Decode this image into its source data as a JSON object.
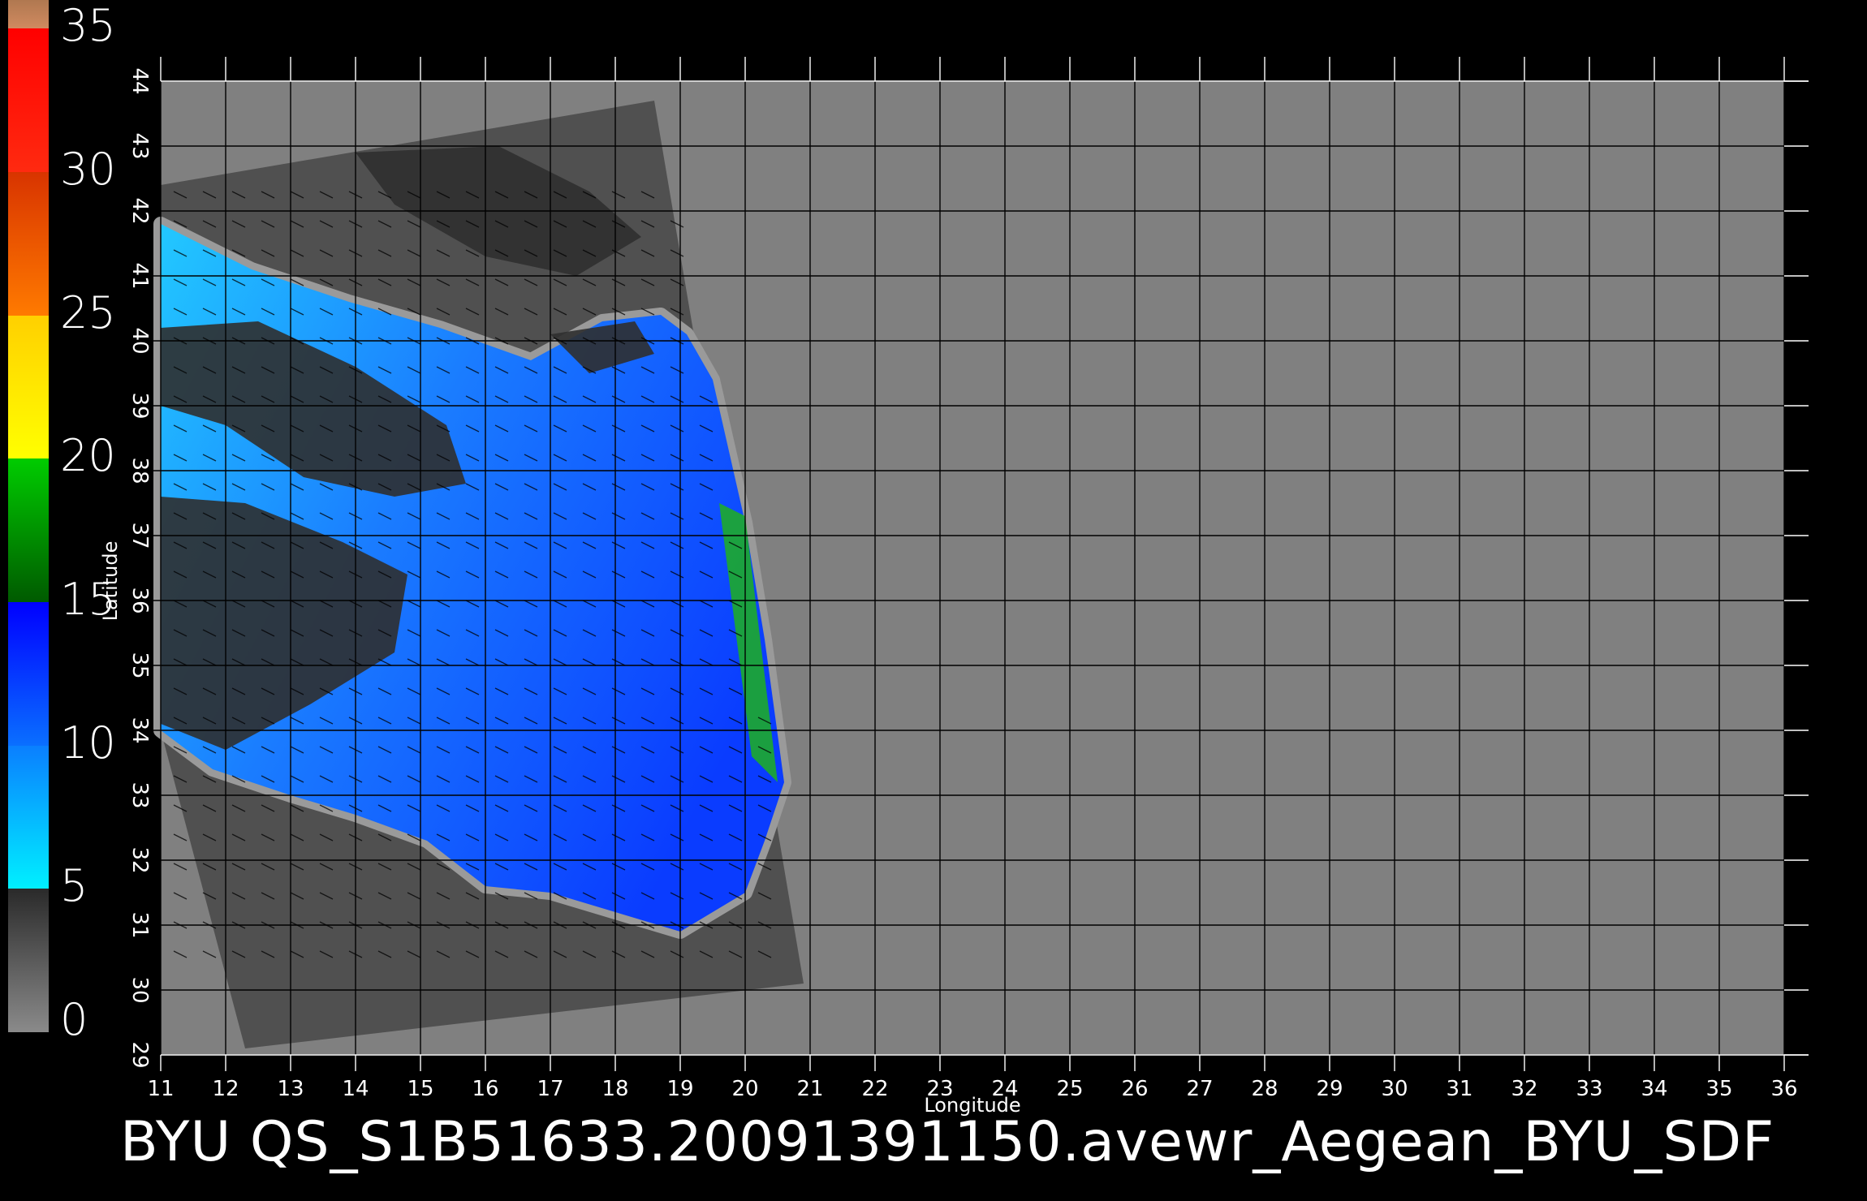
{
  "title": "BYU  QS_S1B51633.20091391150.avewr_Aegean_BYU_SDF",
  "colorbar": {
    "tick_labels": [
      "35",
      "30",
      "25",
      "20",
      "15",
      "10",
      "5",
      "0"
    ],
    "segments": [
      {
        "from": 0,
        "to": 5,
        "color_top": "#2a2a2a",
        "color_bottom": "#8a8a8a"
      },
      {
        "from": 5,
        "to": 10,
        "color_top": "#0a7fff",
        "color_bottom": "#00f0ff"
      },
      {
        "from": 10,
        "to": 15,
        "color_top": "#0000ff",
        "color_bottom": "#0a6fff"
      },
      {
        "from": 15,
        "to": 20,
        "color_top": "#00cc00",
        "color_bottom": "#005a00"
      },
      {
        "from": 20,
        "to": 25,
        "color_top": "#ffd000",
        "color_bottom": "#ffff00"
      },
      {
        "from": 25,
        "to": 30,
        "color_top": "#d83400",
        "color_bottom": "#ff7a00"
      },
      {
        "from": 30,
        "to": 35,
        "color_top": "#ff0000",
        "color_bottom": "#ff2a10"
      },
      {
        "from": 35,
        "to": 36,
        "color_top": "#b07850",
        "color_bottom": "#d08a60"
      }
    ]
  },
  "map": {
    "x_label": "Longitude",
    "y_label": "Latitude",
    "lon_range": [
      11,
      36
    ],
    "lat_range": [
      29,
      44
    ],
    "lon_ticks": [
      "11",
      "12",
      "13",
      "14",
      "15",
      "16",
      "17",
      "18",
      "19",
      "20",
      "21",
      "22",
      "23",
      "24",
      "25",
      "26",
      "27",
      "28",
      "29",
      "30",
      "31",
      "32",
      "33",
      "34",
      "35",
      "36"
    ],
    "lat_ticks": [
      "29",
      "30",
      "31",
      "32",
      "33",
      "34",
      "35",
      "36",
      "37",
      "38",
      "39",
      "40",
      "41",
      "42",
      "43",
      "44"
    ],
    "background_color": "#808080",
    "swath_color": "#505050",
    "land_color": "#2f2f2f",
    "sea_low_color": "#22c8ff",
    "sea_mid_color": "#1a7cff",
    "sea_high_color": "#0a3cff",
    "strong_wind_color": "#1fb01f",
    "grid_color": "#000000",
    "swath_lonlat": [
      [
        11.0,
        42.4
      ],
      [
        18.6,
        43.7
      ],
      [
        20.9,
        30.1
      ],
      [
        12.3,
        29.1
      ],
      [
        11.0,
        34.0
      ]
    ],
    "sea_lonlat": [
      [
        11.0,
        41.8
      ],
      [
        12.4,
        41.1
      ],
      [
        13.9,
        40.6
      ],
      [
        15.3,
        40.2
      ],
      [
        16.7,
        39.7
      ],
      [
        17.8,
        40.3
      ],
      [
        18.7,
        40.4
      ],
      [
        19.1,
        40.1
      ],
      [
        19.5,
        39.4
      ],
      [
        20.0,
        37.2
      ],
      [
        20.3,
        35.4
      ],
      [
        20.6,
        33.2
      ],
      [
        20.3,
        32.3
      ],
      [
        20.0,
        31.5
      ],
      [
        19.0,
        30.9
      ],
      [
        18.0,
        31.2
      ],
      [
        17.0,
        31.5
      ],
      [
        16.0,
        31.6
      ],
      [
        15.1,
        32.3
      ],
      [
        14.0,
        32.7
      ],
      [
        13.0,
        33.0
      ],
      [
        11.8,
        33.4
      ],
      [
        11.0,
        34.0
      ]
    ]
  }
}
